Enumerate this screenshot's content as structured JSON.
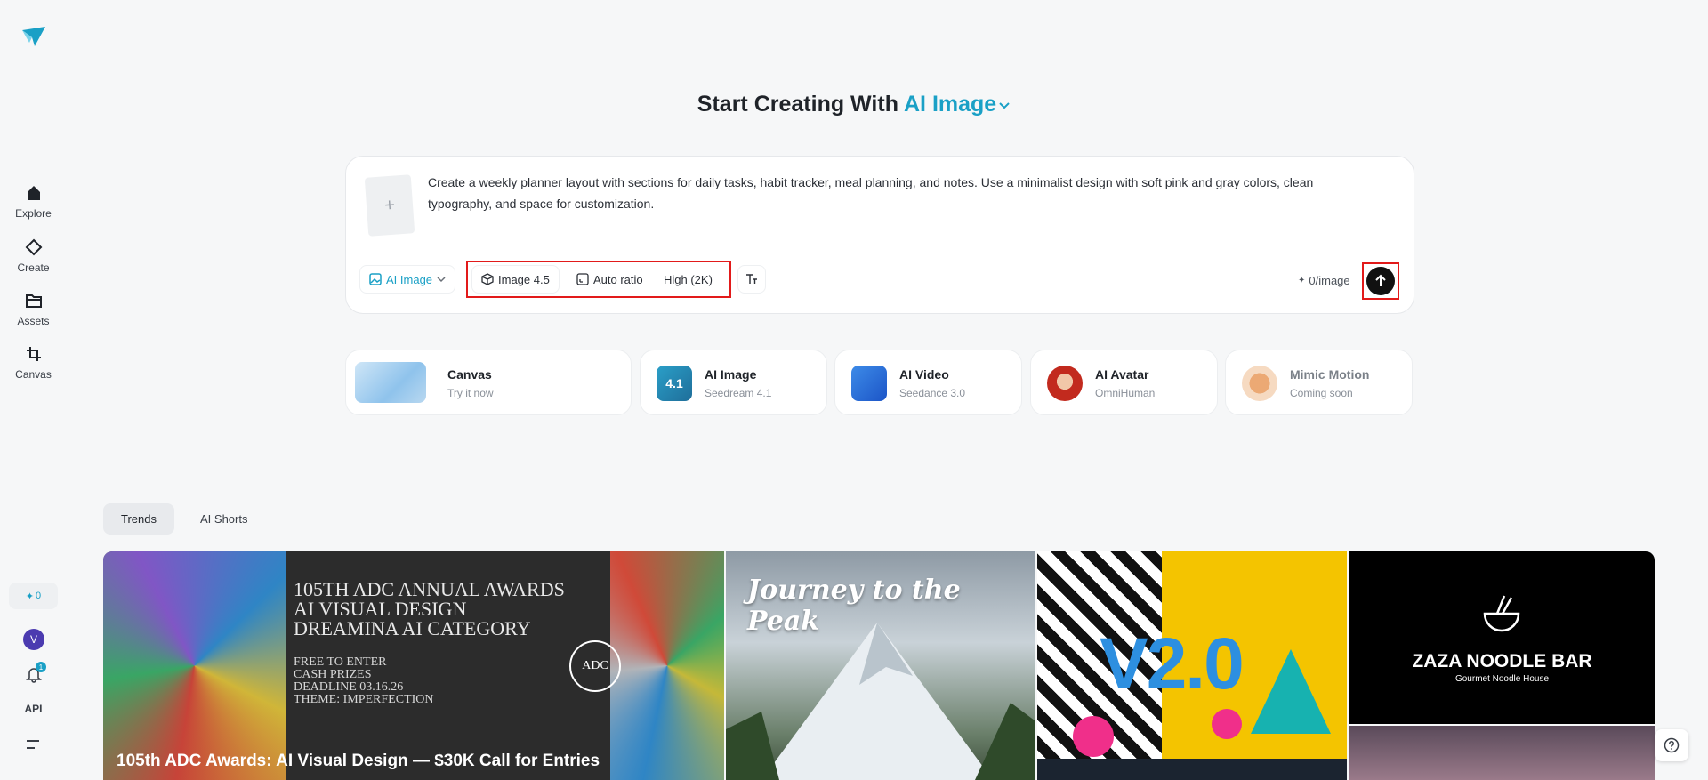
{
  "sidebar": {
    "items": [
      {
        "label": "Explore",
        "icon": "home-icon"
      },
      {
        "label": "Create",
        "icon": "diamond-icon"
      },
      {
        "label": "Assets",
        "icon": "folder-icon"
      },
      {
        "label": "Canvas",
        "icon": "crop-icon"
      }
    ],
    "credits": "0",
    "avatar_initial": "V",
    "notification_count": "1",
    "api_label": "API"
  },
  "heading": {
    "prefix": "Start Creating With",
    "mode": "AI Image"
  },
  "prompt": {
    "text": "Create a weekly planner layout with sections for daily tasks, habit tracker, meal planning, and notes. Use a minimalist design with soft pink and gray colors, clean typography, and space for customization.",
    "upload_symbol": "+",
    "mode_select": "AI Image",
    "model": "Image 4.5",
    "ratio": "Auto ratio",
    "quality": "High (2K)",
    "cost": "0/image"
  },
  "cards": [
    {
      "title": "Canvas",
      "subtitle": "Try it now"
    },
    {
      "title": "AI Image",
      "subtitle": "Seedream 4.1",
      "badge": "4.1"
    },
    {
      "title": "AI Video",
      "subtitle": "Seedance 3.0"
    },
    {
      "title": "AI Avatar",
      "subtitle": "OmniHuman"
    },
    {
      "title": "Mimic Motion",
      "subtitle": "Coming soon"
    }
  ],
  "tabs": [
    {
      "label": "Trends",
      "active": true
    },
    {
      "label": "AI Shorts",
      "active": false
    }
  ],
  "gallery": {
    "tile1": {
      "caption": "105th ADC Awards: AI Visual Design — $30K Call for Entries",
      "poster_lines": [
        "105TH ADC ANNUAL AWARDS",
        "AI VISUAL DESIGN",
        "DREAMINA AI CATEGORY"
      ],
      "poster_details": [
        "FREE TO ENTER",
        "CASH PRIZES",
        "DEADLINE 03.16.26",
        "THEME: IMPERFECTION"
      ],
      "seal": "ADC"
    },
    "tile2": {
      "title": "Journey to the Peak"
    },
    "tile3": {
      "title": "V2.0"
    },
    "tile4": {
      "title": "ZAZA NOODLE BAR",
      "subtitle": "Gourmet Noodle House"
    }
  },
  "colors": {
    "accent": "#1aa0c6",
    "highlight": "#e21a1a",
    "background": "#f6f7f8"
  }
}
